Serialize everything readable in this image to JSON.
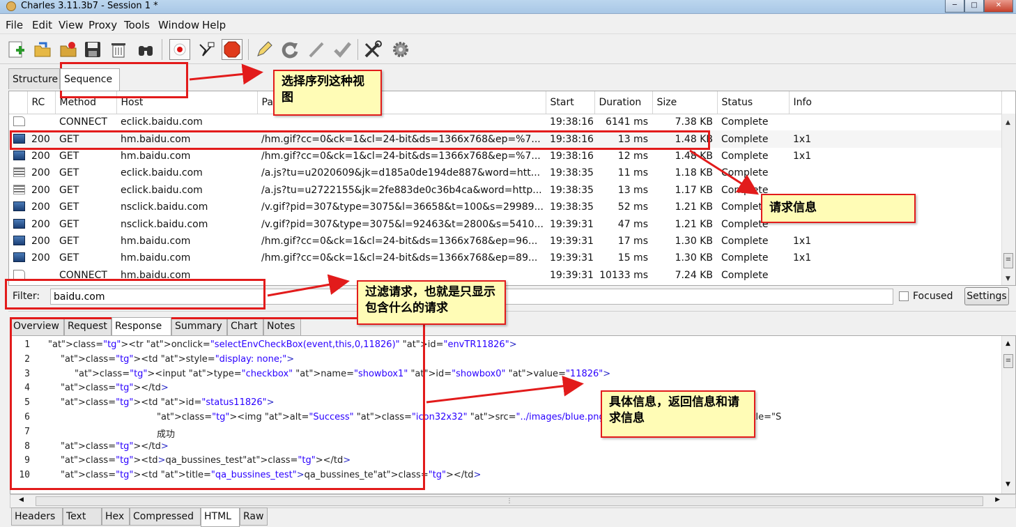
{
  "window": {
    "title": "Charles 3.11.3b7 - Session 1 *"
  },
  "menu": [
    "File",
    "Edit",
    "View",
    "Proxy",
    "Tools",
    "Window",
    "Help"
  ],
  "view_tabs": [
    "Structure",
    "Sequence"
  ],
  "grid": {
    "columns": [
      "RC",
      "Method",
      "Host",
      "Path",
      "Start",
      "Duration",
      "Size",
      "Status",
      "Info"
    ],
    "rows": [
      {
        "icon": "document-icon",
        "rc": "",
        "method": "CONNECT",
        "host": "eclick.baidu.com",
        "path": "",
        "start": "19:38:16",
        "duration": "6141 ms",
        "size": "7.38 KB",
        "status": "Complete",
        "info": ""
      },
      {
        "icon": "image-icon",
        "rc": "200",
        "method": "GET",
        "host": "hm.baidu.com",
        "path": "/hm.gif?cc=0&ck=1&cl=24-bit&ds=1366x768&ep=%7...",
        "start": "19:38:16",
        "duration": "13 ms",
        "size": "1.48 KB",
        "status": "Complete",
        "info": "1x1"
      },
      {
        "icon": "image-icon",
        "rc": "200",
        "method": "GET",
        "host": "hm.baidu.com",
        "path": "/hm.gif?cc=0&ck=1&cl=24-bit&ds=1366x768&ep=%7...",
        "start": "19:38:16",
        "duration": "12 ms",
        "size": "1.48 KB",
        "status": "Complete",
        "info": "1x1"
      },
      {
        "icon": "script-icon",
        "rc": "200",
        "method": "GET",
        "host": "eclick.baidu.com",
        "path": "/a.js?tu=u2020609&jk=d185a0de194de887&word=htt...",
        "start": "19:38:35",
        "duration": "11 ms",
        "size": "1.18 KB",
        "status": "Complete",
        "info": ""
      },
      {
        "icon": "script-icon",
        "rc": "200",
        "method": "GET",
        "host": "eclick.baidu.com",
        "path": "/a.js?tu=u2722155&jk=2fe883de0c36b4ca&word=http...",
        "start": "19:38:35",
        "duration": "13 ms",
        "size": "1.17 KB",
        "status": "Complete",
        "info": ""
      },
      {
        "icon": "image-icon",
        "rc": "200",
        "method": "GET",
        "host": "nsclick.baidu.com",
        "path": "/v.gif?pid=307&type=3075&l=36658&t=100&s=29989...",
        "start": "19:38:35",
        "duration": "52 ms",
        "size": "1.21 KB",
        "status": "Complete",
        "info": ""
      },
      {
        "icon": "image-icon",
        "rc": "200",
        "method": "GET",
        "host": "nsclick.baidu.com",
        "path": "/v.gif?pid=307&type=3075&l=92463&t=2800&s=5410...",
        "start": "19:39:31",
        "duration": "47 ms",
        "size": "1.21 KB",
        "status": "Complete",
        "info": ""
      },
      {
        "icon": "image-icon",
        "rc": "200",
        "method": "GET",
        "host": "hm.baidu.com",
        "path": "/hm.gif?cc=0&ck=1&cl=24-bit&ds=1366x768&ep=96...",
        "start": "19:39:31",
        "duration": "17 ms",
        "size": "1.30 KB",
        "status": "Complete",
        "info": "1x1"
      },
      {
        "icon": "image-icon",
        "rc": "200",
        "method": "GET",
        "host": "hm.baidu.com",
        "path": "/hm.gif?cc=0&ck=1&cl=24-bit&ds=1366x768&ep=89...",
        "start": "19:39:31",
        "duration": "15 ms",
        "size": "1.30 KB",
        "status": "Complete",
        "info": "1x1"
      },
      {
        "icon": "document-icon",
        "rc": "",
        "method": "CONNECT",
        "host": "hm.baidu.com",
        "path": "",
        "start": "19:39:31",
        "duration": "10133 ms",
        "size": "7.24 KB",
        "status": "Complete",
        "info": ""
      }
    ]
  },
  "filter": {
    "label": "Filter:",
    "value": "baidu.com",
    "focused_label": "Focused",
    "settings_label": "Settings"
  },
  "detail_tabs": [
    "Overview",
    "Request",
    "Response",
    "Summary",
    "Chart",
    "Notes"
  ],
  "detail_tabs_selected": "Response",
  "body_tabs": [
    "Headers",
    "Text",
    "Hex",
    "Compressed",
    "HTML",
    "Raw"
  ],
  "body_tabs_selected": "HTML",
  "code_lines": [
    "<tr onclick=\"selectEnvCheckBox(event,this,0,11826)\" id=\"envTR11826\">",
    "<td style=\"display: none;\">",
    "<input type=\"checkbox\" name=\"showbox1\" id=\"showbox0\" value=\"11826\">",
    "</td>",
    "<td id=\"status11826\">",
    "<img alt=\"Success\" class=\"icon32x32\" src=\"../images/blue.png\" tooltip=\"Success\" title=\"S",
    "成功",
    "</td>",
    "<td>qa_bussines_test</td>",
    "<td title=\"qa_bussines_test\">qa_bussines_te</td>"
  ],
  "annotations": {
    "sequence_note": "选择序列这种视图",
    "request_note": "请求信息",
    "filter_note": "过滤请求，也就是只显示包含什么的请求",
    "detail_note": "具体信息，返回信息和请求信息"
  },
  "colors": {
    "annotation_red": "#e21b1b",
    "note_fill": "#fffcb6"
  }
}
